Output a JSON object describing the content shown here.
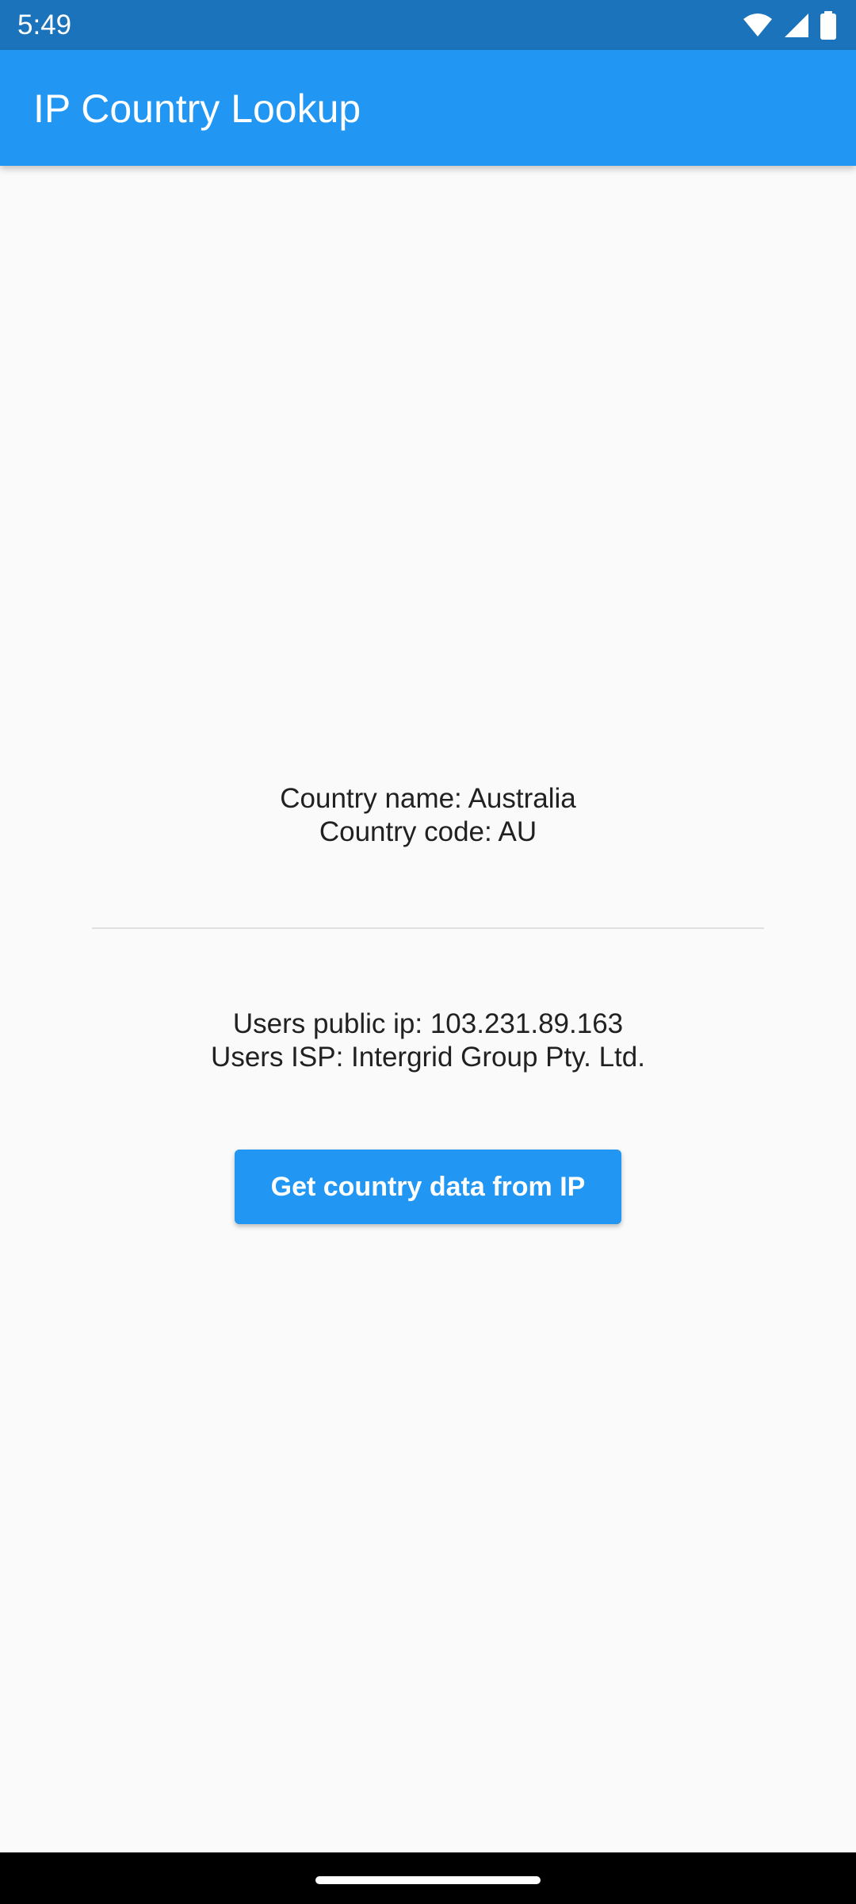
{
  "status_bar": {
    "time": "5:49",
    "icons": [
      "wifi-icon",
      "signal-icon",
      "battery-icon"
    ]
  },
  "app_bar": {
    "title": "IP Country Lookup"
  },
  "country_info": {
    "name_line": "Country name: Australia",
    "code_line": "Country code: AU"
  },
  "ip_info": {
    "ip_line": "Users public ip: 103.231.89.163",
    "isp_line": "Users ISP: Intergrid Group Pty. Ltd."
  },
  "actions": {
    "get_country_label": "Get country data from IP"
  },
  "colors": {
    "status_bar": "#1b74bb",
    "app_bar": "#2196f3",
    "button": "#2196f3",
    "background": "#fafafa"
  }
}
